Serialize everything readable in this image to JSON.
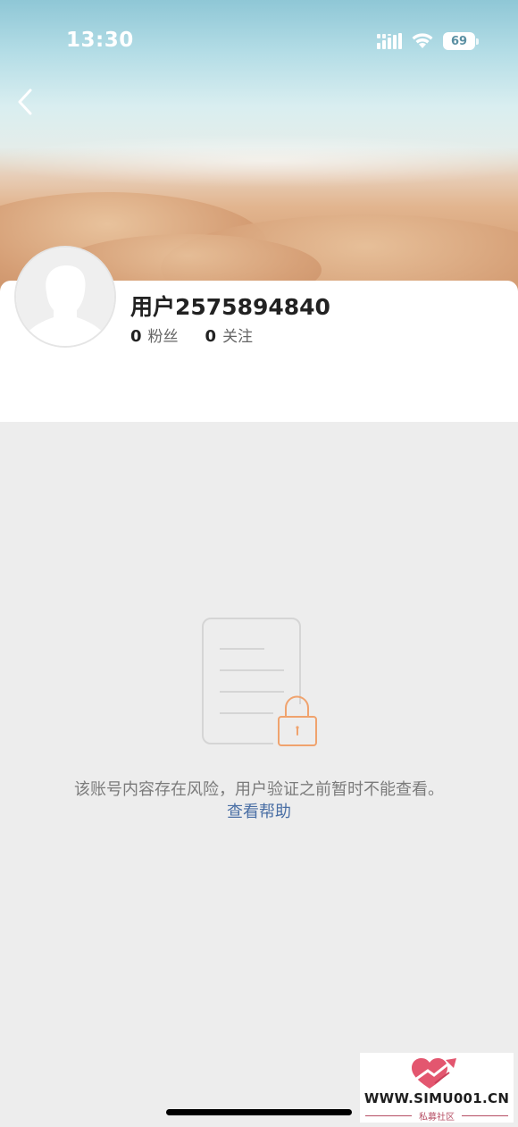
{
  "status_bar": {
    "time": "13:30",
    "battery_level": "69",
    "icons": [
      "signal-icon",
      "wifi-icon",
      "battery-icon"
    ]
  },
  "nav": {
    "back_icon": "chevron-left-icon"
  },
  "profile": {
    "username": "用户2575894840",
    "followers_count": "0",
    "followers_label": "粉丝",
    "following_count": "0",
    "following_label": "关注",
    "avatar_icon": "default-avatar-icon"
  },
  "notice": {
    "illustration_icon": "locked-document-icon",
    "message": "该账号内容存在风险，用户验证之前暂时不能查看。",
    "help_link": "查看帮助"
  },
  "watermark": {
    "domain": "WWW.SIMU001.CN",
    "subtitle": "私募社区",
    "logo_icon": "heart-arrow-logo-icon"
  },
  "colors": {
    "link": "#4a6fa5",
    "lock_accent": "#f0a36e",
    "background": "#ededed",
    "watermark_accent": "#b64e64"
  }
}
